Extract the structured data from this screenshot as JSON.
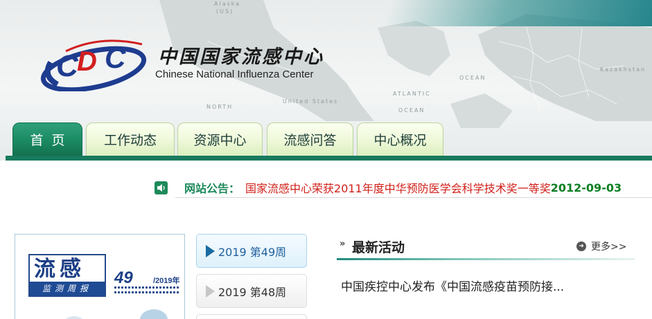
{
  "header": {
    "org_name_cn": "中国国家流感中心",
    "org_name_en": "Chinese National Influenza Center",
    "logo_icon": "cnic-logo",
    "map_labels": [
      "Alaska (US)",
      "NORTH",
      "United States",
      "ATLANTIC",
      "OCEAN",
      "ATLANTIC",
      "OCEAN",
      "Kazakhstan"
    ]
  },
  "nav": {
    "tabs": [
      {
        "label": "首页",
        "active": true
      },
      {
        "label": "工作动态",
        "active": false
      },
      {
        "label": "资源中心",
        "active": false
      },
      {
        "label": "流感问答",
        "active": false
      },
      {
        "label": "中心概况",
        "active": false
      }
    ]
  },
  "notice": {
    "icon": "speaker-icon",
    "label": "网站公告：",
    "text": "国家流感中心荣获2011年度中华预防医学会科学技术奖一等奖",
    "date": "2012-09-03"
  },
  "bulletin": {
    "title_top": "流感",
    "title_bottom": "监测周报",
    "issue_number": "49",
    "issue_year": "/2019年"
  },
  "weeks": [
    {
      "label": "2019 第49周",
      "active": true
    },
    {
      "label": "2019 第48周",
      "active": false
    }
  ],
  "activities": {
    "title": "最新活动",
    "more_label": "更多>>",
    "items": [
      "中国疾控中心发布《中国流感疫苗预防接..."
    ]
  },
  "colors": {
    "primary_green": "#1a8a63",
    "nav_bar": "#177a5e",
    "notice_red": "#d0201a",
    "date_green": "#0a7f22",
    "week_blue": "#1f5f9c"
  }
}
